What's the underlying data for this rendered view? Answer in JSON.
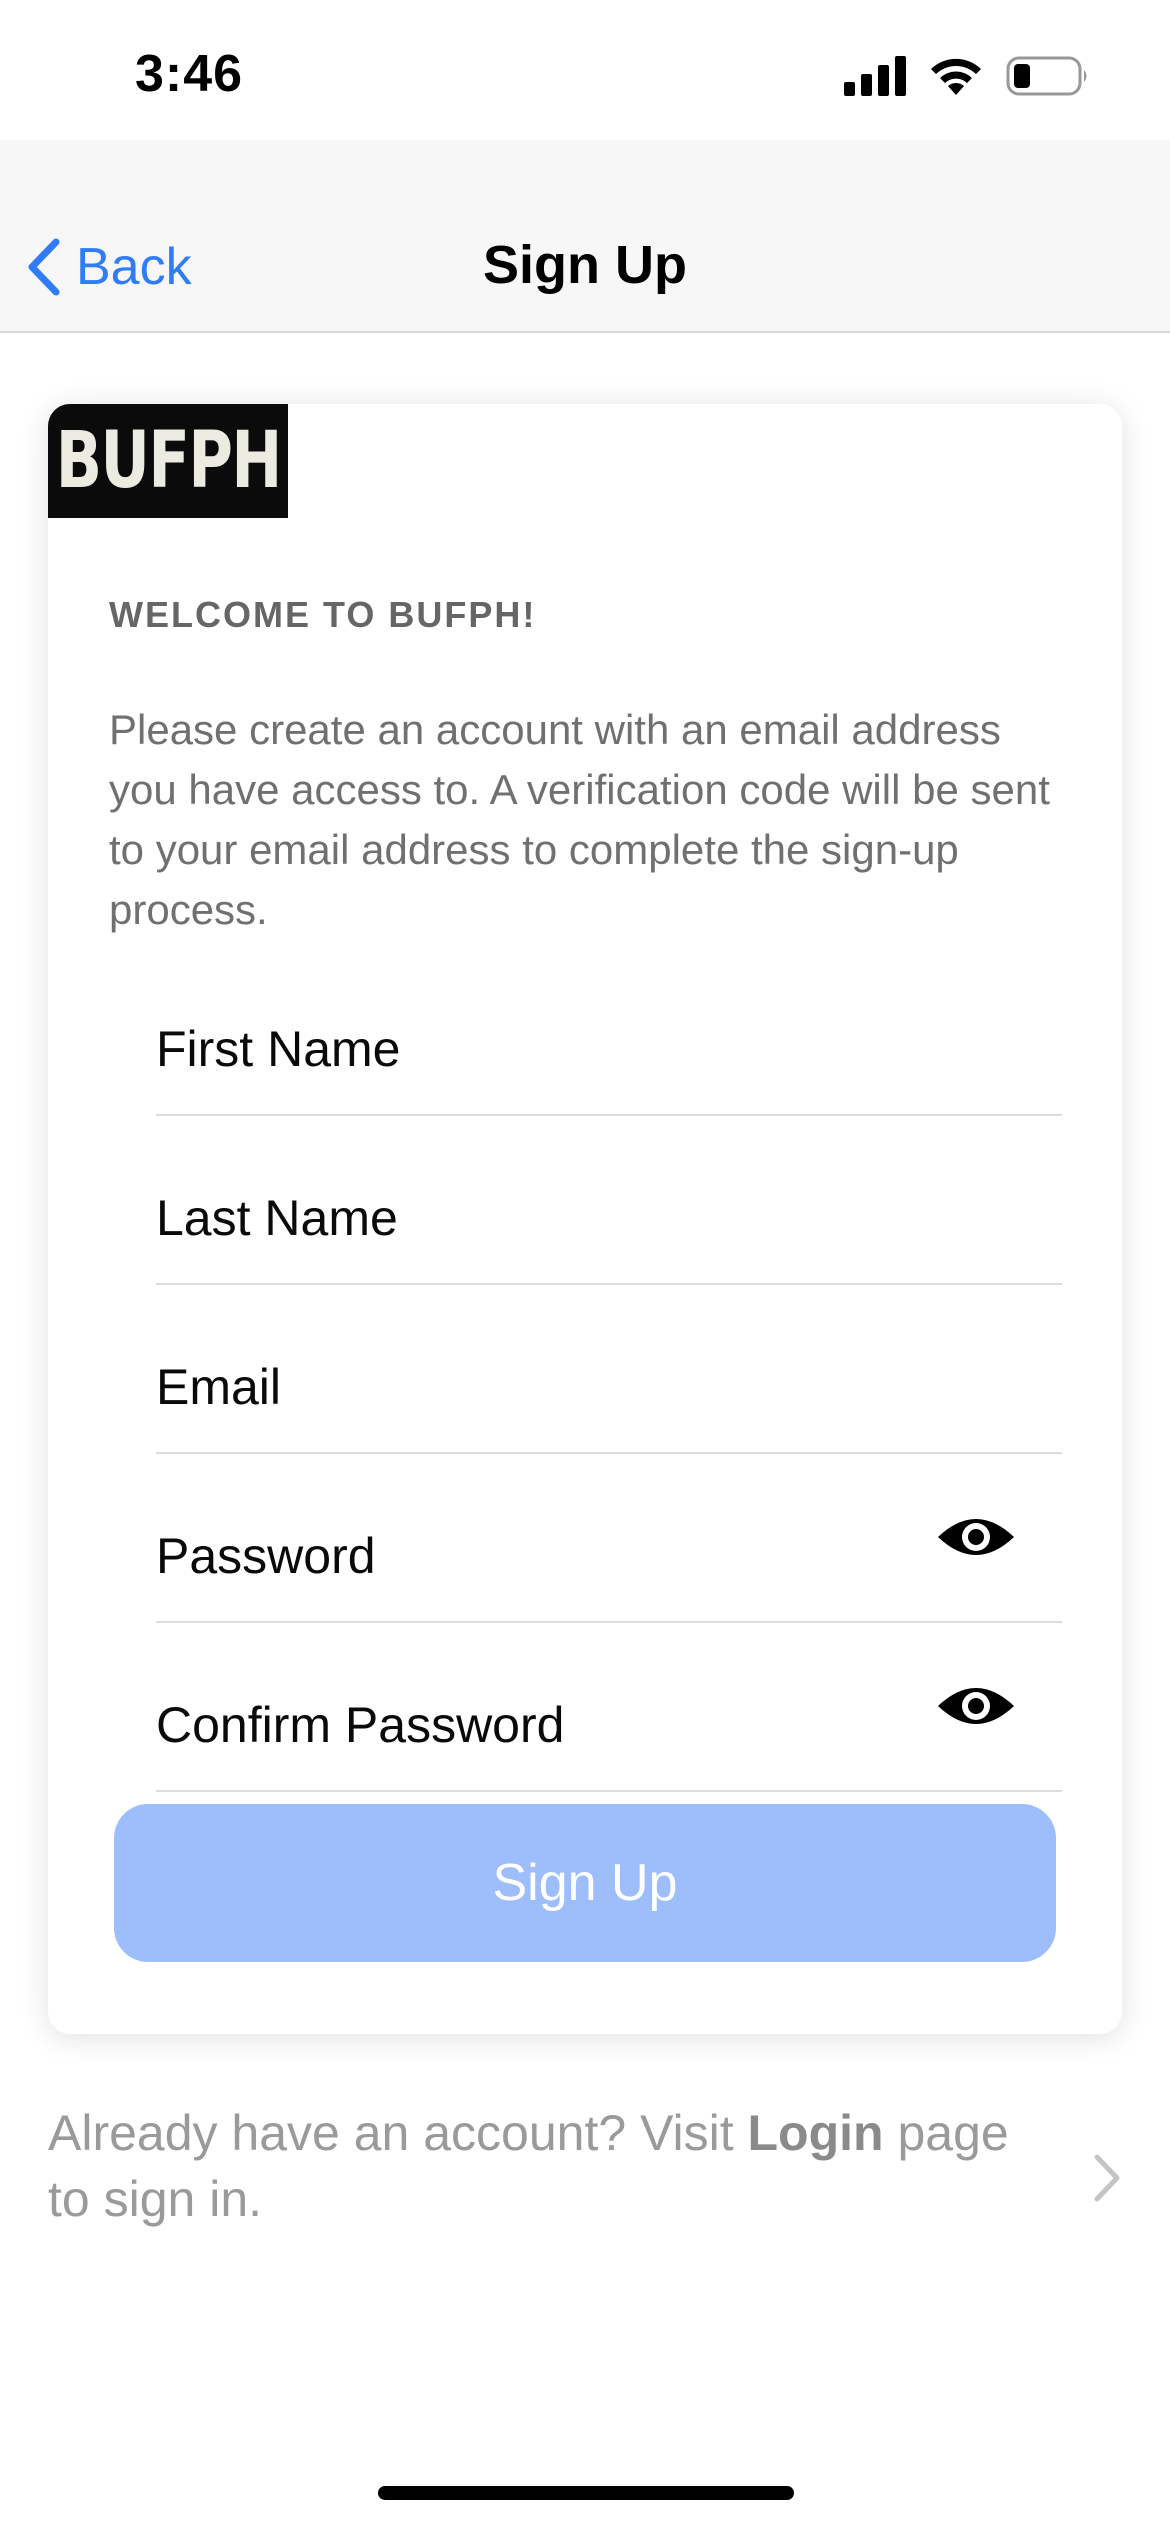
{
  "status_bar": {
    "time": "3:46"
  },
  "nav": {
    "back_label": "Back",
    "title": "Sign Up"
  },
  "card": {
    "logo_text": "BUFPH",
    "welcome": "WELCOME TO BUFPH!",
    "intro": "Please create an account with an email address you have access to. A verification code will be sent to your email address to complete the sign-up process.",
    "fields": {
      "first_name": "First Name",
      "last_name": "Last Name",
      "email": "Email",
      "password": "Password",
      "confirm_password": "Confirm Password"
    },
    "signup_button": "Sign Up"
  },
  "login_prompt": {
    "prefix": "Already have an account? Visit ",
    "link": "Login",
    "suffix": " page to sign in."
  },
  "colors": {
    "accent": "#2f7cf6",
    "button_disabled": "#9dbefb"
  },
  "icons": [
    "cellular-signal-icon",
    "wifi-icon",
    "battery-icon",
    "chevron-left-icon",
    "eye-icon",
    "chevron-right-icon"
  ]
}
